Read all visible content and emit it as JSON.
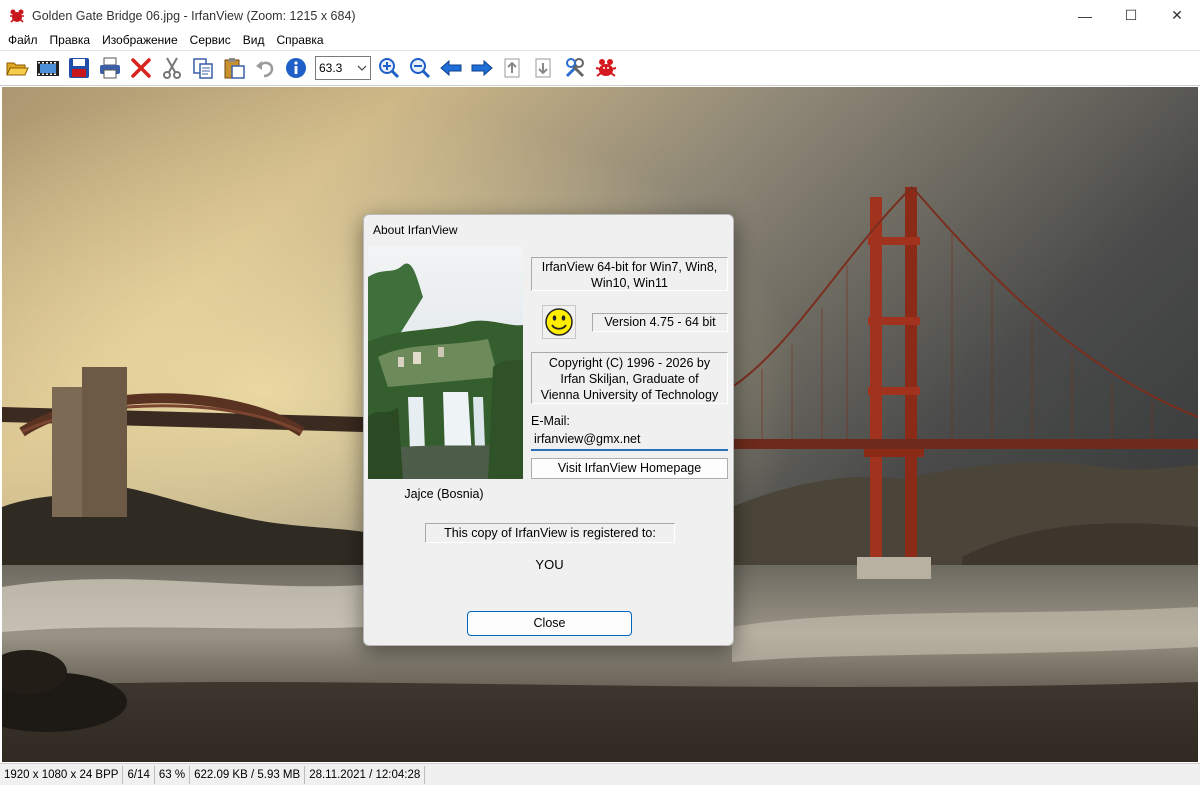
{
  "window": {
    "title": "Golden Gate Bridge 06.jpg - IrfanView (Zoom: 1215 x 684)",
    "controls": {
      "minimize": "—",
      "maximize": "☐",
      "close": "✕"
    }
  },
  "menu": [
    "Файл",
    "Правка",
    "Изображение",
    "Сервис",
    "Вид",
    "Справка"
  ],
  "toolbar": {
    "zoom_value": "63.3",
    "icons": [
      "open-folder-icon",
      "filmstrip-icon",
      "save-icon",
      "print-icon",
      "delete-icon",
      "cut-icon",
      "copy-icon",
      "paste-icon",
      "undo-icon",
      "info-icon",
      "zoom-in-icon",
      "zoom-out-icon",
      "previous-icon",
      "next-icon",
      "page-up-icon",
      "page-down-icon",
      "settings-icon",
      "irfanview-logo-icon"
    ]
  },
  "dialog": {
    "title": "About  IrfanView",
    "product_line1": "IrfanView 64-bit for Win7, Win8,",
    "product_line2": "Win10, Win11",
    "version": "Version 4.75 - 64 bit",
    "copyright_line1": "Copyright (C) 1996 - 2026 by",
    "copyright_line2": "Irfan Skiljan, Graduate of",
    "copyright_line3": "Vienna University of Technology",
    "email_label": "E-Mail:",
    "email_value": "irfanview@gmx.net",
    "homepage_button": "Visit IrfanView Homepage",
    "photo_caption": "Jajce (Bosnia)",
    "registered_text": "This copy of IrfanView is registered to:",
    "registered_user": "YOU",
    "close_button": "Close"
  },
  "status": {
    "dimensions": "1920 x 1080 x 24 BPP",
    "index": "6/14",
    "zoom": "63 %",
    "size": "622.09 KB / 5.93 MB",
    "datetime": "28.11.2021 / 12:04:28"
  }
}
